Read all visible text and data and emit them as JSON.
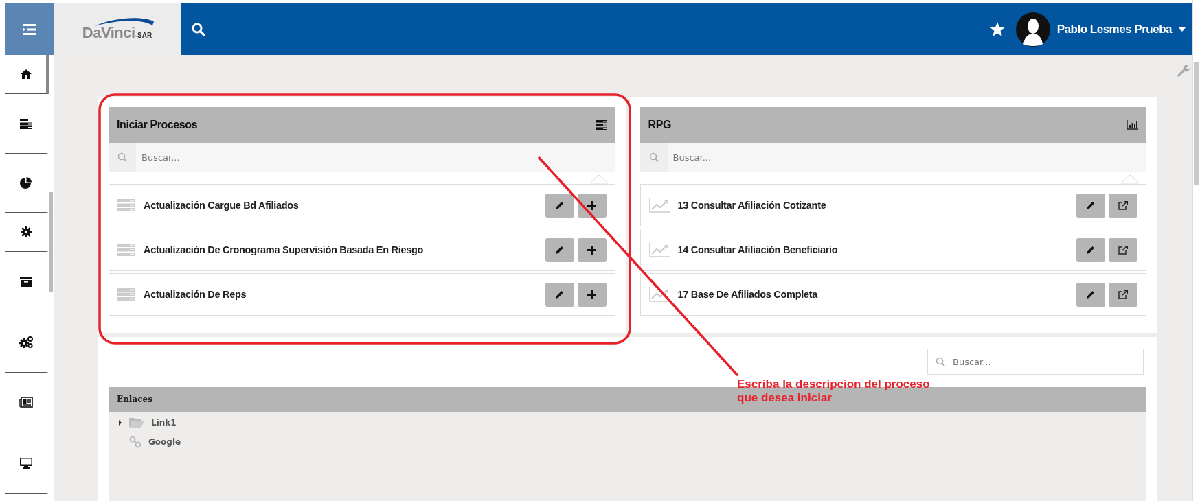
{
  "header": {
    "logo": {
      "brand": "DaVinci",
      "suffix": "-SAR"
    },
    "user_name": "Pablo Lesmes Prueba"
  },
  "sidebar": {
    "items": [
      {
        "selected": true
      },
      {
        "selected": false
      },
      {
        "selected": false
      },
      {
        "selected": false
      },
      {
        "selected": false
      },
      {
        "selected": false
      },
      {
        "selected": false
      },
      {
        "selected": false
      }
    ]
  },
  "panels": [
    {
      "kind": "processes",
      "title": "Iniciar Procesos",
      "search": {
        "placeholder": "Buscar..."
      },
      "items": [
        {
          "label": "Actualización Cargue Bd Afiliados"
        },
        {
          "label": "Actualización De Cronograma Supervisión Basada En Riesgo"
        },
        {
          "label": "Actualización De Reps"
        }
      ]
    },
    {
      "kind": "reports",
      "title": "RPG",
      "search": {
        "placeholder": "Buscar..."
      },
      "items": [
        {
          "label": "13 Consultar Afiliación Cotizante"
        },
        {
          "label": "14 Consultar Afiliación Beneficiario"
        },
        {
          "label": "17 Base De Afiliados Completa"
        }
      ]
    }
  ],
  "links": {
    "search": {
      "placeholder": "Buscar..."
    },
    "title": "Enlaces",
    "tree": [
      {
        "kind": "folder",
        "label": "Link1",
        "expanded": false
      },
      {
        "kind": "link",
        "label": "Google"
      }
    ]
  },
  "annotation": {
    "text": "Escriba la descripcion del proceso que desea iniciar"
  }
}
